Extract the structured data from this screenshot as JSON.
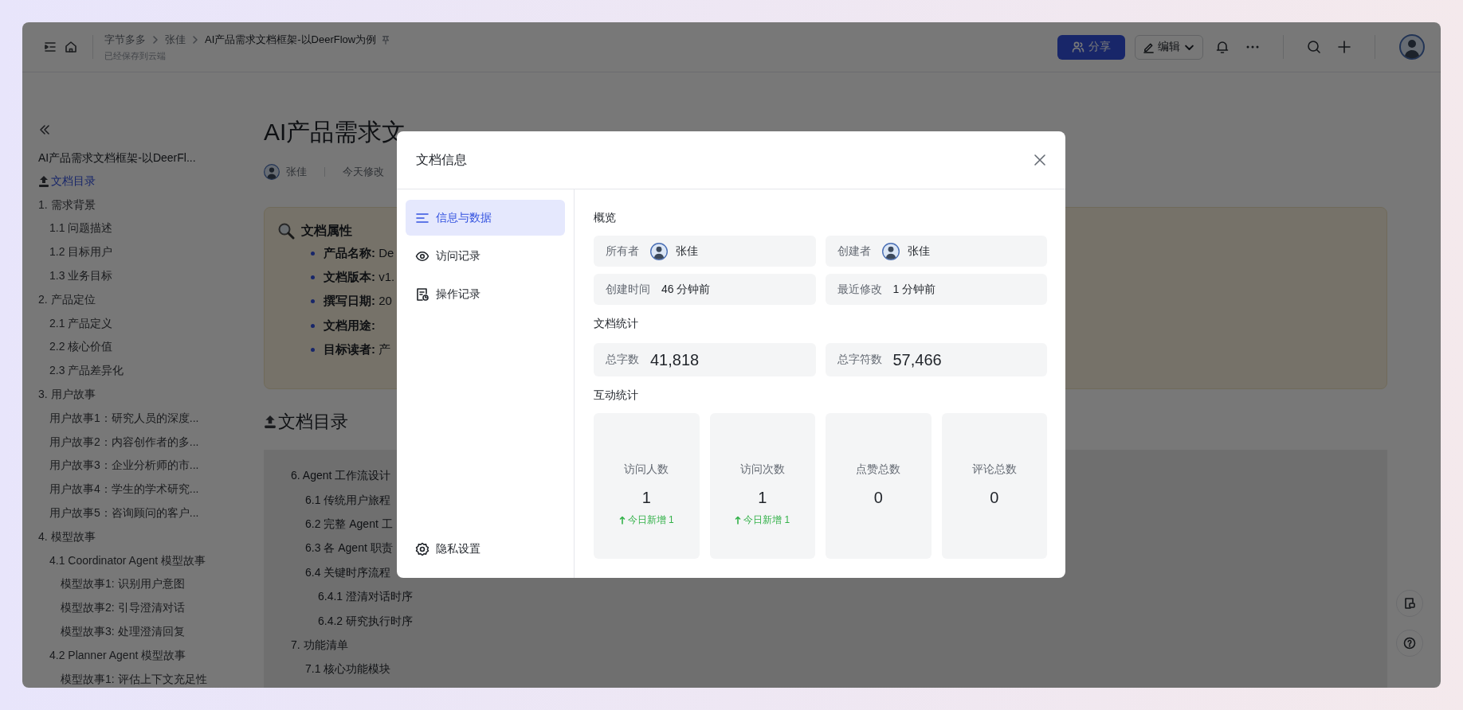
{
  "header": {
    "breadcrumb": [
      {
        "label": "字节多多"
      },
      {
        "label": "张佳"
      },
      {
        "label": "AI产品需求文档框架-以DeerFlow为例"
      }
    ],
    "save_status": "已经保存到云端",
    "share_button": "分享",
    "edit_button": "编辑"
  },
  "sidebar": {
    "title": "AI产品需求文档框架-以DeerFl...",
    "items": [
      {
        "label": "文档目录",
        "selected": true
      },
      {
        "label": "1. 需求背景",
        "selected": false,
        "children": [
          {
            "label": "1.1 问题描述",
            "selected": false
          },
          {
            "label": "1.2 目标用户",
            "selected": false
          },
          {
            "label": "1.3 业务目标",
            "selected": false
          }
        ]
      },
      {
        "label": "2. 产品定位",
        "selected": false,
        "children": [
          {
            "label": "2.1 产品定义",
            "selected": false
          },
          {
            "label": "2.2 核心价值",
            "selected": false
          },
          {
            "label": "2.3 产品差异化",
            "selected": false
          }
        ]
      },
      {
        "label": "3. 用户故事",
        "selected": false,
        "children": [
          {
            "label": "用户故事1：研究人员的深度...",
            "selected": false
          },
          {
            "label": "用户故事2：内容创作者的多...",
            "selected": false
          },
          {
            "label": "用户故事3：企业分析师的市...",
            "selected": false
          },
          {
            "label": "用户故事4：学生的学术研究...",
            "selected": false
          },
          {
            "label": "用户故事5：咨询顾问的客户...",
            "selected": false
          }
        ]
      },
      {
        "label": "4. 模型故事",
        "selected": false,
        "children": [
          {
            "label": "4.1 Coordinator Agent 模型故事",
            "selected": false,
            "children": [
              {
                "label": "模型故事1: 识别用户意图",
                "selected": false
              },
              {
                "label": "模型故事2: 引导澄清对话",
                "selected": false
              },
              {
                "label": "模型故事3: 处理澄清回复",
                "selected": false
              }
            ]
          },
          {
            "label": "4.2 Planner Agent 模型故事",
            "selected": false,
            "children": [
              {
                "label": "模型故事1: 评估上下文充足性",
                "selected": false
              }
            ]
          }
        ]
      }
    ]
  },
  "document": {
    "title": "AI产品需求文",
    "author": "张佳",
    "modified": "今天修改",
    "properties": {
      "heading": "文档属性",
      "items": [
        "**产品名称:** De",
        "**文档版本:** v1.",
        "**撰写日期:** 20",
        "**文档用途:**",
        "**目标读者:** 产"
      ]
    },
    "toc": {
      "heading": "文档目录",
      "items": [
        {
          "label": "6. Agent 工作流设计",
          "children": [
            {
              "label": "6.1 传统用户旅程"
            },
            {
              "label": "6.2 完整 Agent 工"
            },
            {
              "label": "6.3 各 Agent 职责"
            },
            {
              "label": "6.4 关键时序流程",
              "children": [
                {
                  "label": "6.4.1 澄清对话时序"
                },
                {
                  "label": "6.4.2 研究执行时序"
                }
              ]
            }
          ]
        },
        {
          "label": "7. 功能清单",
          "children": [
            {
              "label": "7.1 核心功能模块"
            }
          ]
        }
      ]
    }
  },
  "dialog": {
    "title": "文档信息",
    "nav": [
      {
        "label": "信息与数据",
        "selected": true
      },
      {
        "label": "访问记录",
        "selected": false
      },
      {
        "label": "操作记录",
        "selected": false
      }
    ],
    "privacy": "隐私设置",
    "overview": {
      "heading": "概览",
      "fields": [
        {
          "label": "所有者",
          "value": "张佳",
          "kind": "person"
        },
        {
          "label": "创建者",
          "value": "张佳",
          "kind": "person"
        },
        {
          "label": "创建时间",
          "value": "46 分钟前",
          "kind": "text"
        },
        {
          "label": "最近修改",
          "value": "1 分钟前",
          "kind": "text"
        }
      ]
    },
    "stats": {
      "heading": "文档统计",
      "items": [
        {
          "label": "总字数",
          "value": "41,818"
        },
        {
          "label": "总字符数",
          "value": "57,466"
        }
      ]
    },
    "interaction": {
      "heading": "互动统计",
      "tiles": [
        {
          "label": "访问人数",
          "value": "1",
          "delta": "今日新增 1"
        },
        {
          "label": "访问次数",
          "value": "1",
          "delta": "今日新增 1"
        },
        {
          "label": "点赞总数",
          "value": "0"
        },
        {
          "label": "评论总数",
          "value": "0"
        }
      ]
    }
  }
}
